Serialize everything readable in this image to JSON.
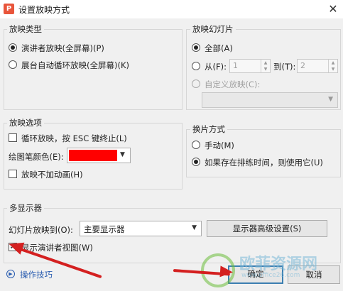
{
  "window": {
    "title": "设置放映方式",
    "close_glyph": "✕",
    "app_glyph": "P"
  },
  "show_type": {
    "label": "放映类型",
    "options": [
      "演讲者放映(全屏幕)(P)",
      "展台自动循环放映(全屏幕)(K)"
    ],
    "selected": 0
  },
  "slides": {
    "label": "放映幻灯片",
    "all_label": "全部(A)",
    "from_label": "从(F):",
    "from_value": "1",
    "to_label": "到(T):",
    "to_value": "2",
    "custom_label": "自定义放映(C):",
    "selected": "all"
  },
  "show_options": {
    "label": "放映选项",
    "loop_label": "循环放映，按 ESC 键终止(L)",
    "loop_checked": false,
    "pen_color_label": "绘图笔颜色(E):",
    "pen_color": "#ff0000",
    "no_animation_label": "放映不加动画(H)",
    "no_animation_checked": false
  },
  "advance": {
    "label": "换片方式",
    "manual_label": "手动(M)",
    "timing_label": "如果存在排练时间，则使用它(U)",
    "selected": "timing"
  },
  "multi_monitor": {
    "label": "多显示器",
    "show_on_label": "幻灯片放映到(O):",
    "show_on_value": "主要显示器",
    "advanced_button": "显示器高级设置(S)",
    "presenter_view_label": "显示演讲者视图(W)",
    "presenter_view_checked": true
  },
  "footer": {
    "tips_label": "操作技巧",
    "ok_label": "确定",
    "cancel_label": "取消"
  },
  "watermark": {
    "text": "欧菲资源网",
    "url": "www.office26.com"
  },
  "colors": {
    "accent": "#3c7fb1",
    "arrow": "#d42020",
    "brand": "#e8553b",
    "link": "#2a5db0"
  }
}
